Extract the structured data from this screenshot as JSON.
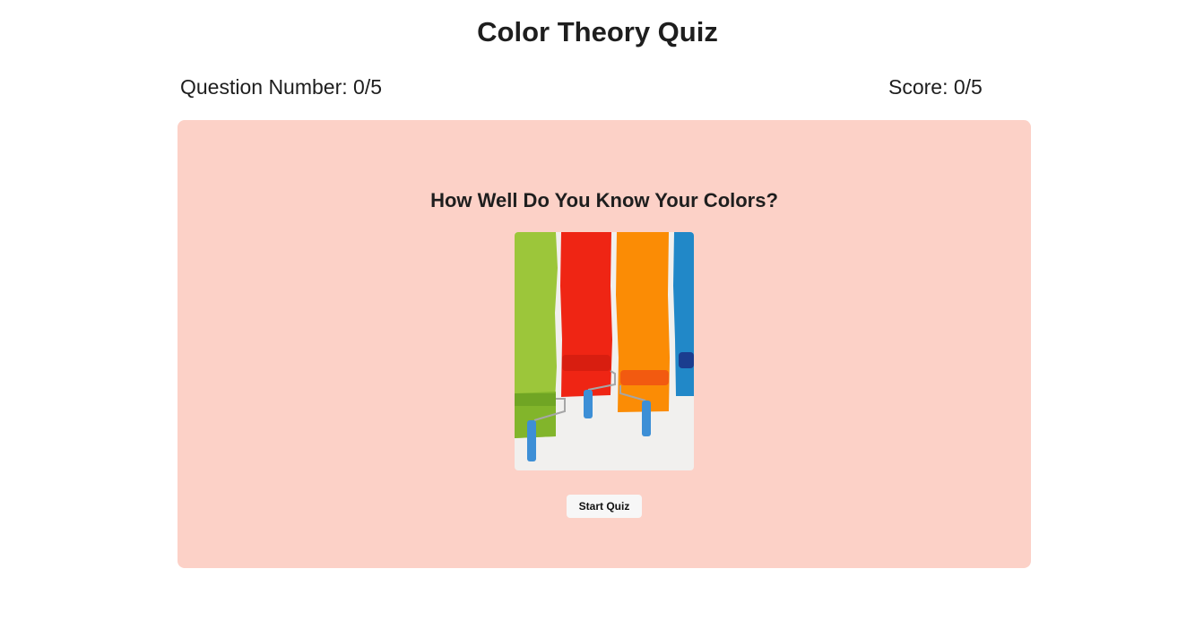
{
  "page": {
    "title": "Color Theory Quiz"
  },
  "stats": {
    "question_number": "Question Number: 0/5",
    "score": "Score: 0/5"
  },
  "card": {
    "background": "#fcd1c7",
    "heading": "How Well Do You Know Your Colors?",
    "image_name": "paint-rollers-image",
    "start_button_label": "Start Quiz"
  }
}
